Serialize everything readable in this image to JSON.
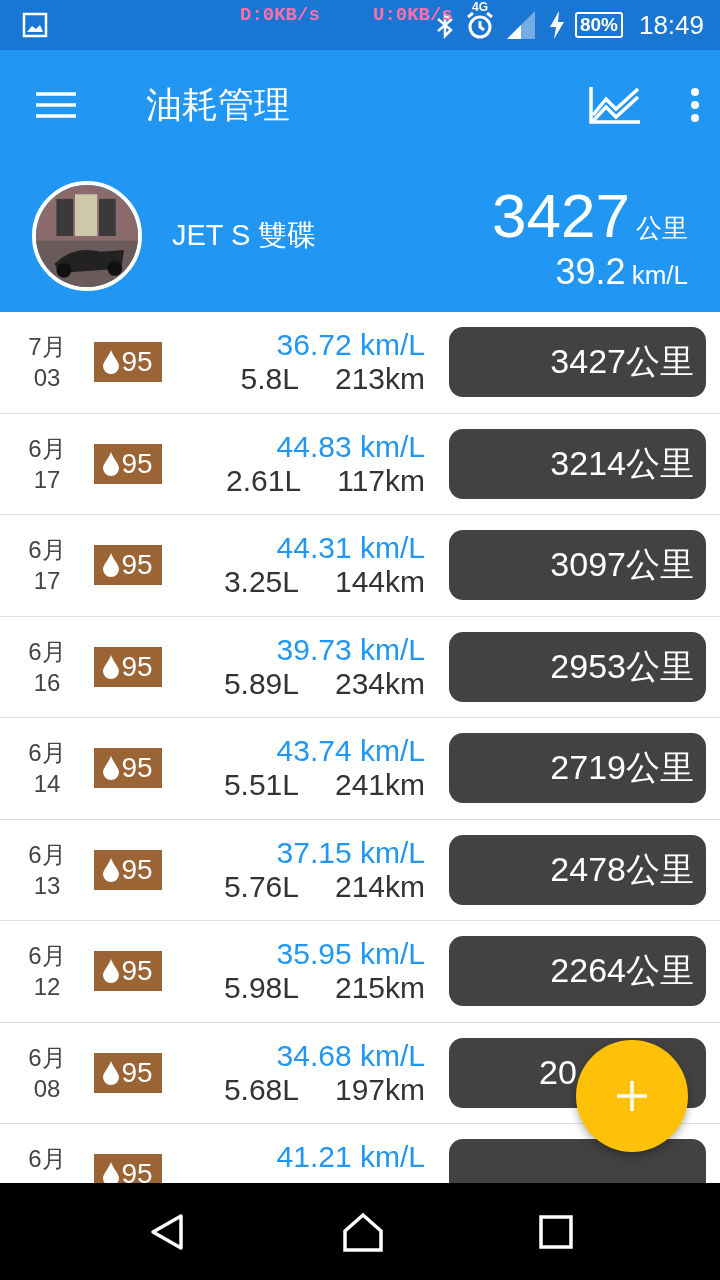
{
  "status_bar": {
    "download": "D:0KB/s",
    "upload": "U:0KB/s",
    "network": "4G",
    "battery": "80%",
    "time": "18:49"
  },
  "app_bar": {
    "title": "油耗管理"
  },
  "vehicle": {
    "name": "JET S 雙碟",
    "odometer": "3427",
    "odometer_unit": "公里",
    "efficiency": "39.2",
    "efficiency_unit": "km/L"
  },
  "records": [
    {
      "month": "7月",
      "day": "03",
      "fuel": "95",
      "efficiency": "36.72 km/L",
      "liters": "5.8L",
      "distance": "213km",
      "odometer": [
        "3427公里"
      ]
    },
    {
      "month": "6月",
      "day": "17",
      "fuel": "95",
      "efficiency": "44.83 km/L",
      "liters": "2.61L",
      "distance": "117km",
      "odometer": [
        "3214公里"
      ]
    },
    {
      "month": "6月",
      "day": "17",
      "fuel": "95",
      "efficiency": "44.31 km/L",
      "liters": "3.25L",
      "distance": "144km",
      "odometer": [
        "3097公里"
      ]
    },
    {
      "month": "6月",
      "day": "16",
      "fuel": "95",
      "efficiency": "39.73 km/L",
      "liters": "5.89L",
      "distance": "234km",
      "odometer": [
        "2953公里"
      ]
    },
    {
      "month": "6月",
      "day": "14",
      "fuel": "95",
      "efficiency": "43.74 km/L",
      "liters": "5.51L",
      "distance": "241km",
      "odometer": [
        "2719公里"
      ]
    },
    {
      "month": "6月",
      "day": "13",
      "fuel": "95",
      "efficiency": "37.15 km/L",
      "liters": "5.76L",
      "distance": "214km",
      "odometer": [
        "2478公里"
      ]
    },
    {
      "month": "6月",
      "day": "12",
      "fuel": "95",
      "efficiency": "35.95 km/L",
      "liters": "5.98L",
      "distance": "215km",
      "odometer": [
        "2264公里"
      ]
    },
    {
      "month": "6月",
      "day": "08",
      "fuel": "95",
      "efficiency": "34.68 km/L",
      "liters": "5.68L",
      "distance": "197km",
      "odometer": [
        "20"
      ],
      "partial": true
    },
    {
      "month": "6月",
      "fuel": "95",
      "efficiency": "41.21 km/L"
    }
  ]
}
